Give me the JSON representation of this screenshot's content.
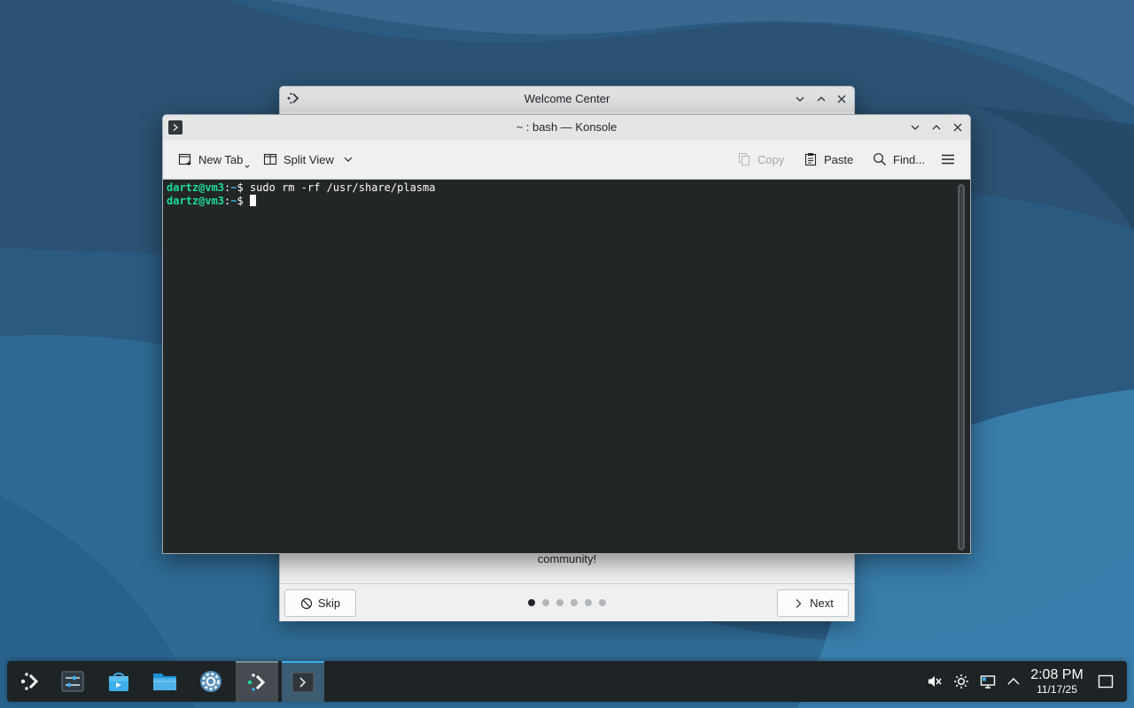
{
  "colors": {
    "accent": "#3daee9",
    "terminal_bg": "#232627",
    "prompt_user": "#1cdc9a",
    "taskbar_bg": "#1e2326"
  },
  "welcome_center": {
    "title": "Welcome Center",
    "icon": "kde-plasma-icon",
    "body_text": "community!",
    "skip_label": "Skip",
    "next_label": "Next",
    "page_count": 6,
    "current_page": 1
  },
  "konsole": {
    "title": "~ : bash — Konsole",
    "toolbar": {
      "new_tab": "New Tab",
      "split_view": "Split View",
      "copy": "Copy",
      "paste": "Paste",
      "find": "Find..."
    },
    "terminal": {
      "lines": [
        {
          "user": "dartz@vm3",
          "sep": ":",
          "path": "~",
          "symbol": "$ ",
          "command": "sudo rm -rf /usr/share/plasma"
        },
        {
          "user": "dartz@vm3",
          "sep": ":",
          "path": "~",
          "symbol": "$ ",
          "command": ""
        }
      ]
    }
  },
  "taskbar": {
    "launchers": [
      {
        "name": "application-launcher-icon"
      },
      {
        "name": "system-settings-sliders-icon"
      },
      {
        "name": "discover-store-icon"
      },
      {
        "name": "dolphin-files-icon"
      },
      {
        "name": "settings-gear-icon"
      },
      {
        "name": "welcome-center-icon"
      },
      {
        "name": "konsole-icon"
      }
    ],
    "tray": {
      "icons": [
        "volume-muted-icon",
        "brightness-icon",
        "network-icon",
        "tray-expand-icon"
      ],
      "time": "2:08 PM",
      "date": "11/17/25"
    }
  }
}
